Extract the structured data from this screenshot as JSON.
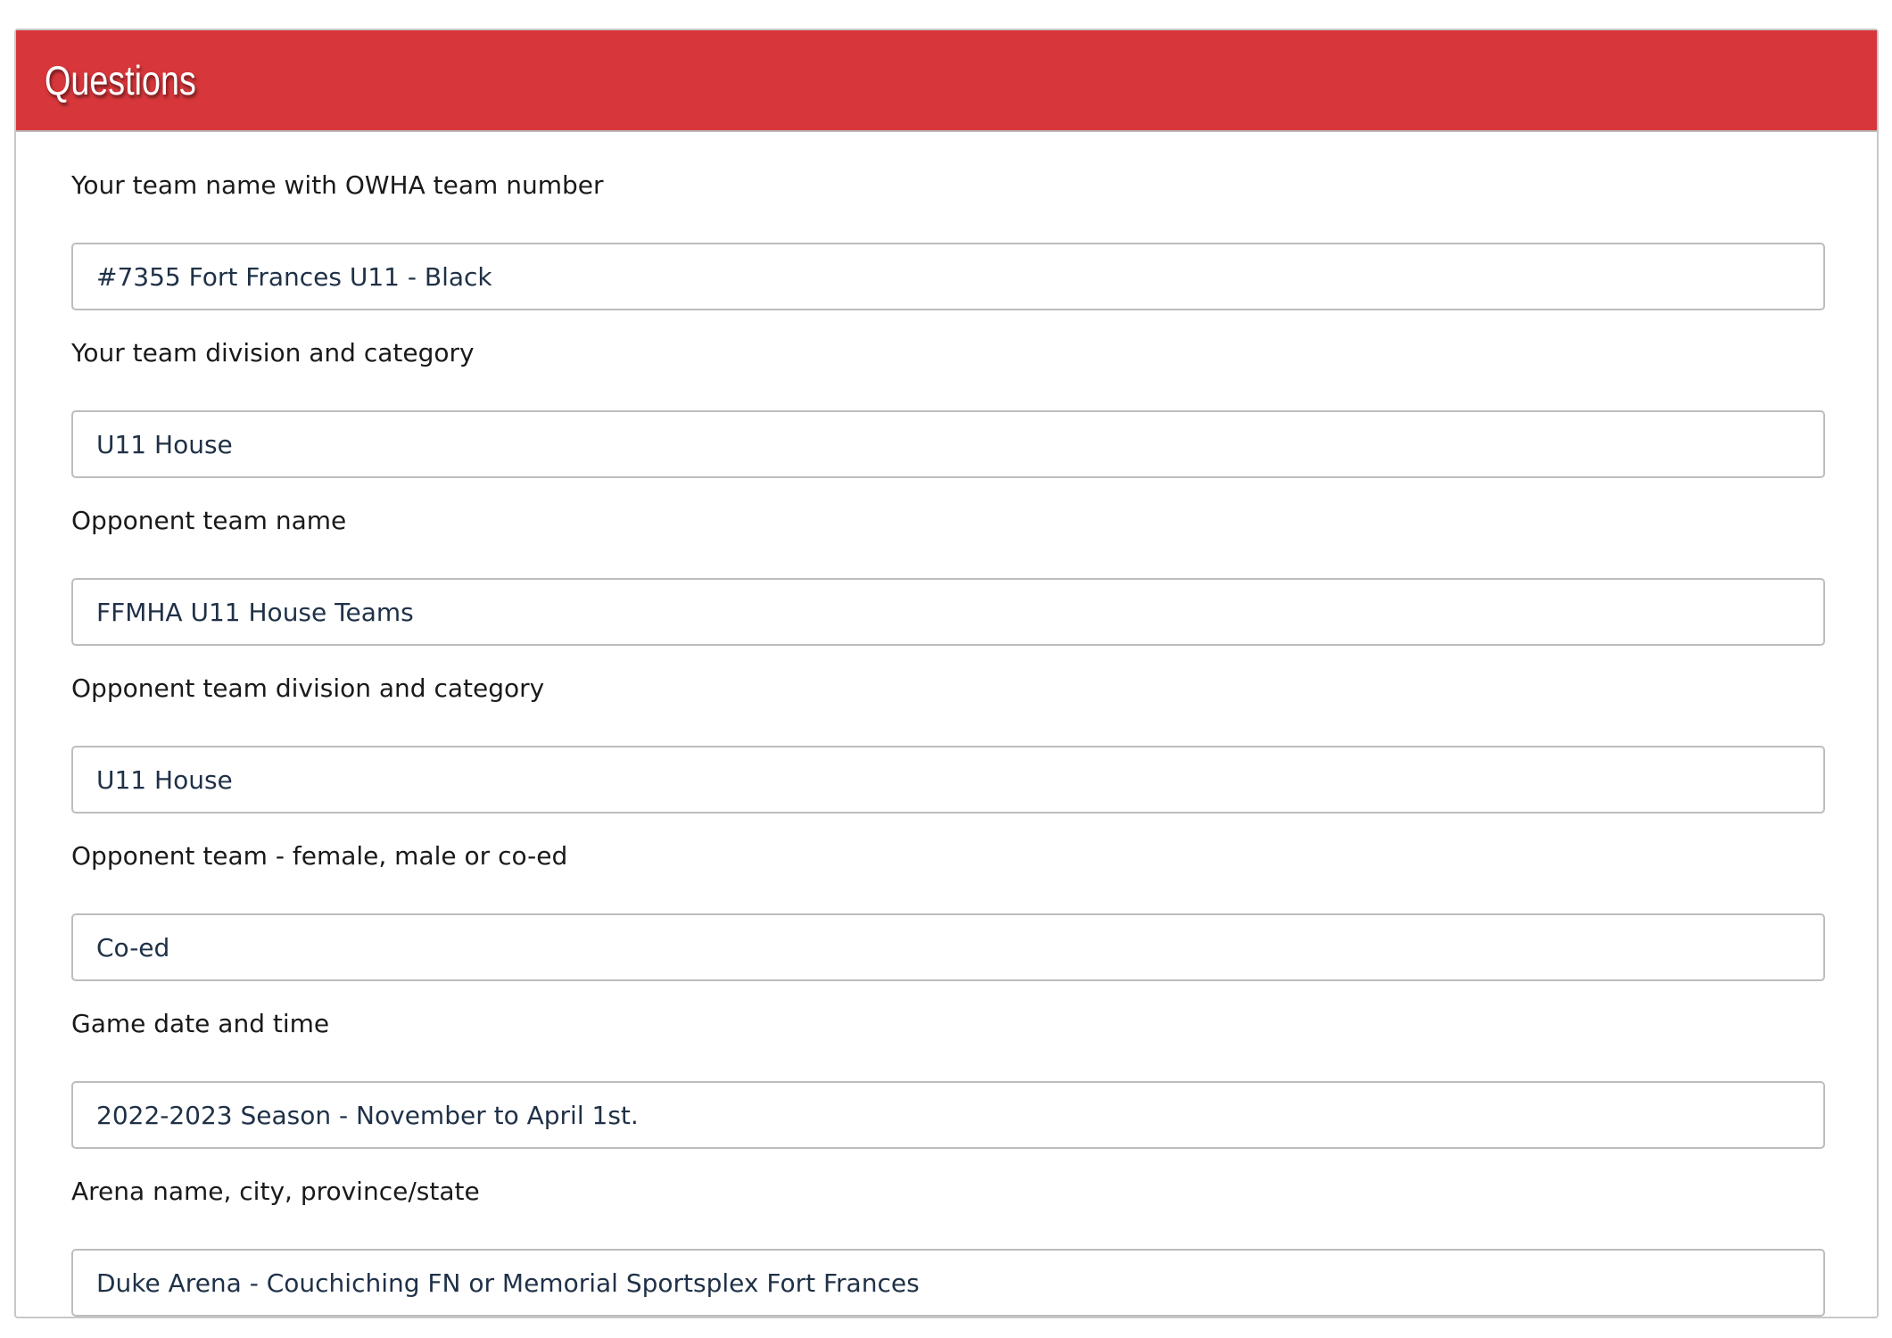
{
  "panel": {
    "title": "Questions",
    "header_color": "#d7373b"
  },
  "fields": [
    {
      "label": "Your team name with OWHA team number",
      "value": "#7355 Fort Frances U11 - Black"
    },
    {
      "label": "Your team division and category",
      "value": "U11 House"
    },
    {
      "label": "Opponent team name",
      "value": "FFMHA U11 House Teams"
    },
    {
      "label": "Opponent team division and category",
      "value": "U11 House"
    },
    {
      "label": "Opponent team - female, male or co-ed",
      "value": "Co-ed"
    },
    {
      "label": "Game date and time",
      "value": "2022-2023 Season - November to April 1st."
    },
    {
      "label": "Arena name, city, province/state",
      "value": "Duke Arena - Couchiching FN or Memorial Sportsplex Fort Frances"
    }
  ]
}
